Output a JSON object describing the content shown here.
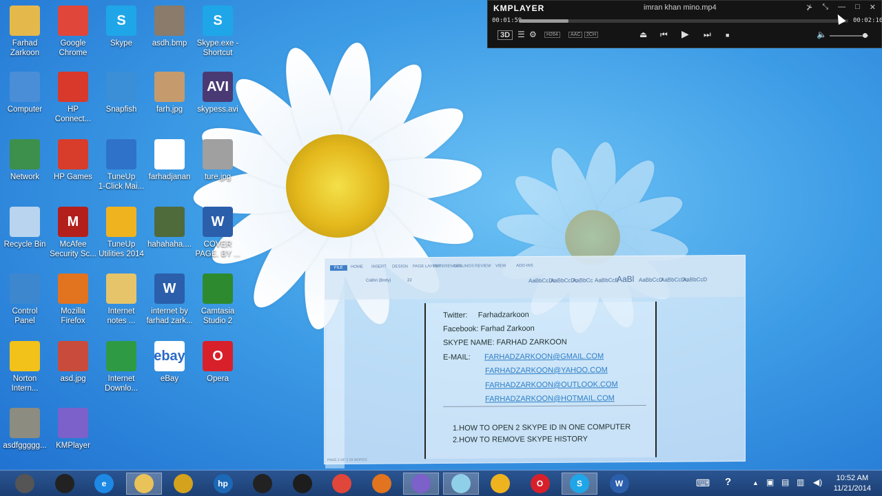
{
  "desktop": {
    "icons": [
      {
        "label1": "Farhad",
        "label2": "Zarkoon",
        "glyph": "",
        "icon": "user-folder-icon",
        "color": "#e5b84c"
      },
      {
        "label1": "Google",
        "label2": "Chrome",
        "glyph": "",
        "icon": "chrome-icon",
        "color": "#e0463a"
      },
      {
        "label1": "Skype",
        "label2": "",
        "glyph": "S",
        "icon": "skype-icon",
        "color": "#1fa6e8"
      },
      {
        "label1": "asdh.bmp",
        "label2": "",
        "glyph": "",
        "icon": "image-file-icon",
        "color": "#8a7b6a"
      },
      {
        "label1": "Skype.exe -",
        "label2": "Shortcut",
        "glyph": "S",
        "icon": "skype-icon",
        "color": "#1fa6e8"
      },
      {
        "label1": "Computer",
        "label2": "",
        "glyph": "",
        "icon": "computer-icon",
        "color": "#4b8ed8"
      },
      {
        "label1": "HP",
        "label2": "Connect...",
        "glyph": "",
        "icon": "hp-connect-icon",
        "color": "#d8392b"
      },
      {
        "label1": "Snapfish",
        "label2": "",
        "glyph": "",
        "icon": "snapfish-icon",
        "color": "#3a8fd6"
      },
      {
        "label1": "farh.jpg",
        "label2": "",
        "glyph": "",
        "icon": "photo-file-icon",
        "color": "#c59b6d"
      },
      {
        "label1": "skypess.avi",
        "label2": "",
        "glyph": "AVI",
        "icon": "video-file-icon",
        "color": "#4a3a73"
      },
      {
        "label1": "Network",
        "label2": "",
        "glyph": "",
        "icon": "network-icon",
        "color": "#3d8f4c"
      },
      {
        "label1": "HP Games",
        "label2": "",
        "glyph": "",
        "icon": "hp-games-icon",
        "color": "#d83c2a"
      },
      {
        "label1": "TuneUp",
        "label2": "1-Click Mai...",
        "glyph": "",
        "icon": "tuneup-maintenance-icon",
        "color": "#2f72c9"
      },
      {
        "label1": "farhadjanan",
        "label2": "",
        "glyph": "",
        "icon": "blank-file-icon",
        "color": "#ffffff"
      },
      {
        "label1": "ture.jpg",
        "label2": "",
        "glyph": "",
        "icon": "photo-file-icon",
        "color": "#a0a0a0"
      },
      {
        "label1": "Recycle Bin",
        "label2": "",
        "glyph": "",
        "icon": "recycle-bin-icon",
        "color": "#b9d4ee"
      },
      {
        "label1": "McAfee",
        "label2": "Security Sc...",
        "glyph": "M",
        "icon": "mcafee-icon",
        "color": "#b3201c"
      },
      {
        "label1": "TuneUp",
        "label2": "Utilities 2014",
        "glyph": "",
        "icon": "tuneup-utilities-icon",
        "color": "#f0b320"
      },
      {
        "label1": "hahahaha....",
        "label2": "",
        "glyph": "",
        "icon": "photo-file-icon",
        "color": "#4f6a3b"
      },
      {
        "label1": "COVER",
        "label2": "PAGE. BY ...",
        "glyph": "W",
        "icon": "word-document-icon",
        "color": "#2b5fab"
      },
      {
        "label1": "Control",
        "label2": "Panel",
        "glyph": "",
        "icon": "control-panel-icon",
        "color": "#3d87cf"
      },
      {
        "label1": "Mozilla",
        "label2": "Firefox",
        "glyph": "",
        "icon": "firefox-icon",
        "color": "#e2731f"
      },
      {
        "label1": "Internet",
        "label2": "notes ...",
        "glyph": "",
        "icon": "folder-icon",
        "color": "#e5c46a"
      },
      {
        "label1": "internet by",
        "label2": "farhad zark...",
        "glyph": "W",
        "icon": "word-document-icon",
        "color": "#2b5fab"
      },
      {
        "label1": "Camtasia",
        "label2": "Studio 2",
        "glyph": "",
        "icon": "camtasia-icon",
        "color": "#2d8a2e"
      },
      {
        "label1": "Norton",
        "label2": "Intern...",
        "glyph": "",
        "icon": "norton-icon",
        "color": "#f2c21b"
      },
      {
        "label1": "asd.jpg",
        "label2": "",
        "glyph": "",
        "icon": "photo-file-icon",
        "color": "#c94b3b"
      },
      {
        "label1": "Internet",
        "label2": "Downlo...",
        "glyph": "",
        "icon": "internet-download-manager-icon",
        "color": "#2e9a44"
      },
      {
        "label1": "eBay",
        "label2": "",
        "glyph": "ebay",
        "icon": "ebay-icon",
        "color": "#ffffff"
      },
      {
        "label1": "Opera",
        "label2": "",
        "glyph": "O",
        "icon": "opera-icon",
        "color": "#d8202b"
      },
      {
        "label1": "asdfggggg...",
        "label2": "",
        "glyph": "",
        "icon": "photo-file-icon",
        "color": "#8c8c80"
      },
      {
        "label1": "KMPlayer",
        "label2": "",
        "glyph": "",
        "icon": "kmplayer-icon",
        "color": "#7b61c9"
      }
    ]
  },
  "kmplayer": {
    "logo": "KMPLAYER",
    "title": "imran khan mino.mp4",
    "elapsed": "00:01:59",
    "total": "00:02:16",
    "progress": 0.15,
    "badge_3d": "3D",
    "badge_codec1": "H264",
    "badge_codec2": "AAC",
    "badge_codec3": "2CH"
  },
  "word": {
    "tabs": [
      "FILE",
      "HOME",
      "INSERT",
      "DESIGN",
      "PAGE LAYOUT",
      "REFERENCES",
      "MAILINGS",
      "REVIEW",
      "VIEW",
      "ADD-INS"
    ],
    "styles": [
      "AaBbCcDc",
      "AaBbCcDc",
      "AaBbCc",
      "AaBbCcE",
      "AaBl",
      "AaBbCcD",
      "AaBbCcDc",
      "AaBbCcD"
    ],
    "font_name": "Calibri (Body)",
    "font_size": "22",
    "twitter_label": "Twitter:",
    "twitter_value": "Farhadzarkoon",
    "facebook_label": "Facebook:",
    "facebook_value": "Farhad Zarkoon",
    "skype_line": "SKYPE NAME: FARHAD ZARKOON",
    "email_label": "E-MAIL:",
    "emails": [
      "FARHADZARKOON@GMAIL.COM",
      "FARHADZARKOON@YAHOO.COM",
      "FARHADZARKOON@OUTLOOK.COM",
      "FARHADZARKOON@HOTMAIL.COM"
    ],
    "items": [
      "1.HOW TO OPEN 2 SKYPE ID IN ONE COMPUTER",
      "2.HOW TO REMOVE SKYPE HISTORY"
    ],
    "status": "PAGE 2 OF 3     29 WORDS"
  },
  "taskbar": {
    "apps": [
      {
        "icon": "camtasia-recorder-icon",
        "glyph": "",
        "color": "#555555"
      },
      {
        "icon": "webcam-icon",
        "glyph": "",
        "color": "#222222"
      },
      {
        "icon": "internet-explorer-icon",
        "glyph": "e",
        "color": "#1e88e5"
      },
      {
        "icon": "file-explorer-icon",
        "glyph": "",
        "color": "#e9c25a"
      },
      {
        "icon": "media-player-icon",
        "glyph": "",
        "color": "#d4a21d"
      },
      {
        "icon": "hp-icon",
        "glyph": "hp",
        "color": "#1b68b7"
      },
      {
        "icon": "dvd-player-icon",
        "glyph": "",
        "color": "#222222"
      },
      {
        "icon": "camtasia-studio-icon",
        "glyph": "",
        "color": "#1d1d1d"
      },
      {
        "icon": "chrome-icon",
        "glyph": "",
        "color": "#e0463a"
      },
      {
        "icon": "firefox-icon",
        "glyph": "",
        "color": "#e2731f"
      },
      {
        "icon": "kmplayer-icon",
        "glyph": "",
        "color": "#7b61c9"
      },
      {
        "icon": "notepad-icon",
        "glyph": "",
        "color": "#8fd0e8"
      },
      {
        "icon": "tuneup-icon",
        "glyph": "",
        "color": "#f0b320"
      },
      {
        "icon": "opera-icon",
        "glyph": "O",
        "color": "#d8202b"
      },
      {
        "icon": "skype-icon",
        "glyph": "S",
        "color": "#1fa6e8"
      },
      {
        "icon": "word-icon",
        "glyph": "W",
        "color": "#2b5fab"
      }
    ],
    "time": "10:52 AM",
    "date": "11/21/2014"
  }
}
